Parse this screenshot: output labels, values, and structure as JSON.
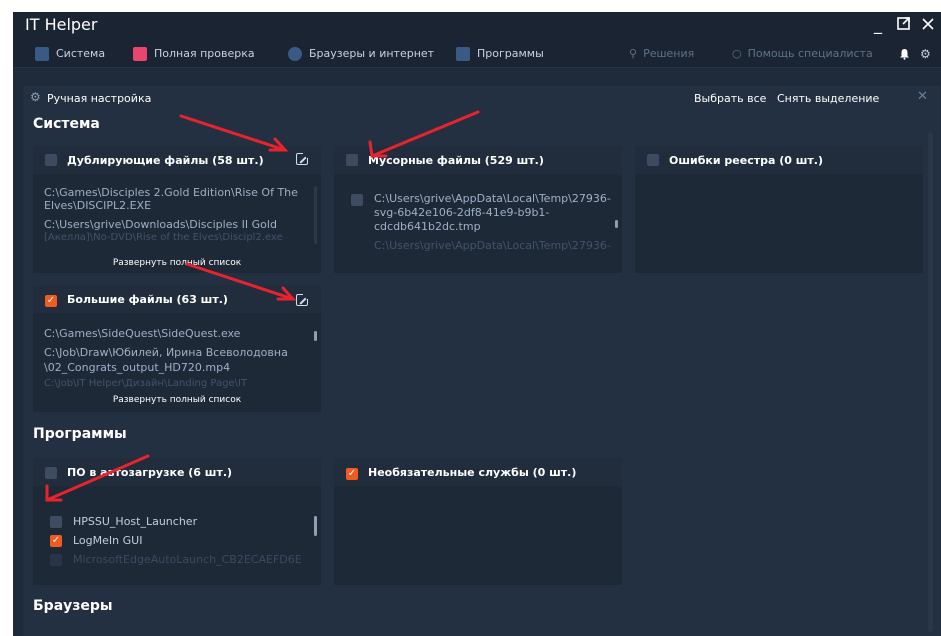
{
  "app": {
    "title": "IT Helper"
  },
  "window_controls": {
    "minimize": "_",
    "maximize": "⧉",
    "close": "✕"
  },
  "nav": {
    "items": [
      {
        "label": "Система",
        "icon": "monitor-icon",
        "color": "#3a5a86"
      },
      {
        "label": "Полная проверка",
        "icon": "home-check-icon",
        "color": "#e8466f"
      },
      {
        "label": "Браузеры и интернет",
        "icon": "globe-icon",
        "color": "#3a5a86"
      },
      {
        "label": "Программы",
        "icon": "apps-icon",
        "color": "#3a5a86"
      }
    ],
    "right_items": [
      {
        "label": "Решения",
        "icon": "search-icon"
      },
      {
        "label": "Помощь специалиста",
        "icon": "help-circle-icon"
      }
    ]
  },
  "panel": {
    "title": "Ручная настройка",
    "select_all": "Выбрать все",
    "deselect": "Снять выделение",
    "close": "✕"
  },
  "sections": {
    "system": "Система",
    "programs": "Программы",
    "browsers": "Браузеры"
  },
  "cards": {
    "duplicates": {
      "title": "Дублирующие файлы (58 шт.)",
      "checked": false,
      "lines": [
        "C:\\Games\\Disciples 2.Gold Edition\\Rise Of The",
        "Elves\\DISCIPL2.EXE",
        "C:\\Users\\grive\\Downloads\\Disciples II Gold",
        "[Акелла]\\No-DVD\\Rise of the Elves\\Discipl2.exe"
      ],
      "expand": "Развернуть полный список"
    },
    "junk": {
      "title": "Мусорные файлы (529 шт.)",
      "checked": false,
      "lines": [
        "C:\\Users\\grive\\AppData\\Local\\Temp\\27936-",
        "svg-6b42e106-2df8-41e9-b9b1-",
        "cdcdb641b2dc.tmp",
        "C:\\Users\\grive\\AppData\\Local\\Temp\\27936-"
      ]
    },
    "registry": {
      "title": "Ошибки реестра (0 шт.)",
      "checked": false
    },
    "large": {
      "title": "Большие файлы (63 шт.)",
      "checked": true,
      "lines": [
        "C:\\Games\\SideQuest\\SideQuest.exe",
        "C:\\Job\\Draw\\Юбилей, Ирина Всеволодовна",
        "\\02_Congrats_output_HD720.mp4",
        "C:\\Job\\IT Helper\\Дизайн\\Landing Page\\IT"
      ],
      "expand": "Развернуть полный список"
    },
    "autostart": {
      "title": "ПО в автозагрузке (6 шт.)",
      "checked": false,
      "items": [
        {
          "label": "HPSSU_Host_Launcher",
          "checked": false
        },
        {
          "label": "LogMeIn GUI",
          "checked": true
        },
        {
          "label": "MicrosoftEdgeAutoLaunch_CB2ECAEFD6E",
          "checked": false
        }
      ]
    },
    "services": {
      "title": "Необязательные службы (0 шт.)",
      "checked": true
    }
  },
  "colors": {
    "accent": "#f05b22",
    "annotation_arrow": "#e8232d",
    "background": "#1f2a3a"
  }
}
